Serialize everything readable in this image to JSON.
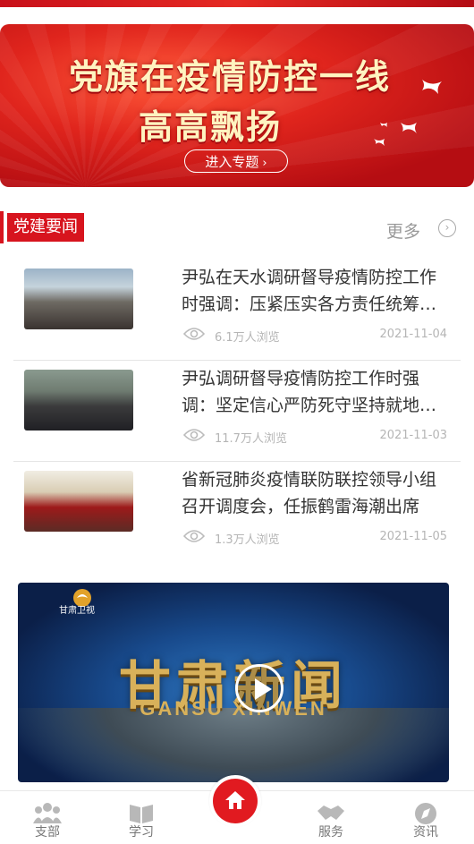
{
  "banner": {
    "line1": "党旗在疫情防控一线",
    "line2": "高高飘扬",
    "button": "进入专题",
    "chevron": "›"
  },
  "section": {
    "title": "党建要闻",
    "more": "更多",
    "more_icon": "›"
  },
  "news": [
    {
      "title": "尹弘在天水调研督导疫情防控工作时强调：压紧压实各方责任统筹推进疫情防控和经济社会发展",
      "views": "6.1万人浏览",
      "date": "2021-11-04"
    },
    {
      "title": "尹弘调研督导疫情防控工作时强调：坚定信心严防死守坚持就地就近全力以赴打赢疫情防控攻坚战",
      "views": "11.7万人浏览",
      "date": "2021-11-03"
    },
    {
      "title": "省新冠肺炎疫情联防联控领导小组召开调度会，任振鹤雷海潮出席",
      "views": "1.3万人浏览",
      "date": "2021-11-05"
    }
  ],
  "video": {
    "channel_logo": "甘肃卫视",
    "title": "甘肃新闻",
    "subtitle": "GANSU XINWEN"
  },
  "tabs": [
    {
      "label": "支部",
      "icon": "group-icon"
    },
    {
      "label": "学习",
      "icon": "book-icon"
    },
    {
      "label": "",
      "icon": "home-icon"
    },
    {
      "label": "服务",
      "icon": "handshake-icon"
    },
    {
      "label": "资讯",
      "icon": "compass-icon"
    }
  ],
  "colors": {
    "brand_red": "#d7141e",
    "banner_text": "#fff3c0",
    "muted": "#b5b5b5"
  }
}
